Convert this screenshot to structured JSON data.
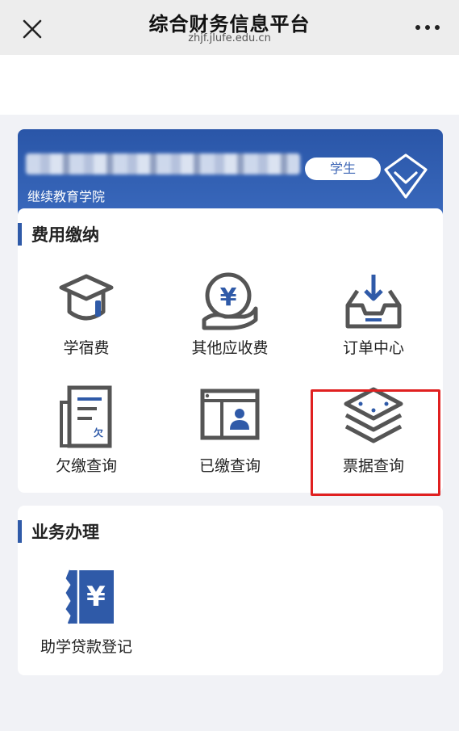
{
  "titlebar": {
    "close_icon": "close-icon",
    "title": "综合财务信息平台",
    "url": "zhjf.jlufe.edu.cn",
    "more_icon": "more-icon"
  },
  "profile": {
    "role": "学生",
    "department": "继续教育学院",
    "colors": {
      "card_bg": "#2a56a8",
      "pill_text": "#3a63b4"
    }
  },
  "sections": {
    "fee": {
      "title": "费用缴纳",
      "items": [
        {
          "label": "学宿费",
          "icon": "graduation-cap-icon"
        },
        {
          "label": "其他应收费",
          "icon": "yen-hand-icon"
        },
        {
          "label": "订单中心",
          "icon": "inbox-download-icon"
        },
        {
          "label": "欠缴查询",
          "icon": "arrears-document-icon"
        },
        {
          "label": "已缴查询",
          "icon": "paid-window-icon"
        },
        {
          "label": "票据查询",
          "icon": "layers-icon"
        }
      ]
    },
    "business": {
      "title": "业务办理",
      "items": [
        {
          "label": "助学贷款登记",
          "icon": "yen-ticket-icon"
        }
      ]
    }
  },
  "accent": {
    "section_bar": "#2f5aa8",
    "highlight": "#e02020",
    "icon_gray": "#555555",
    "icon_blue": "#2f5aa8"
  }
}
